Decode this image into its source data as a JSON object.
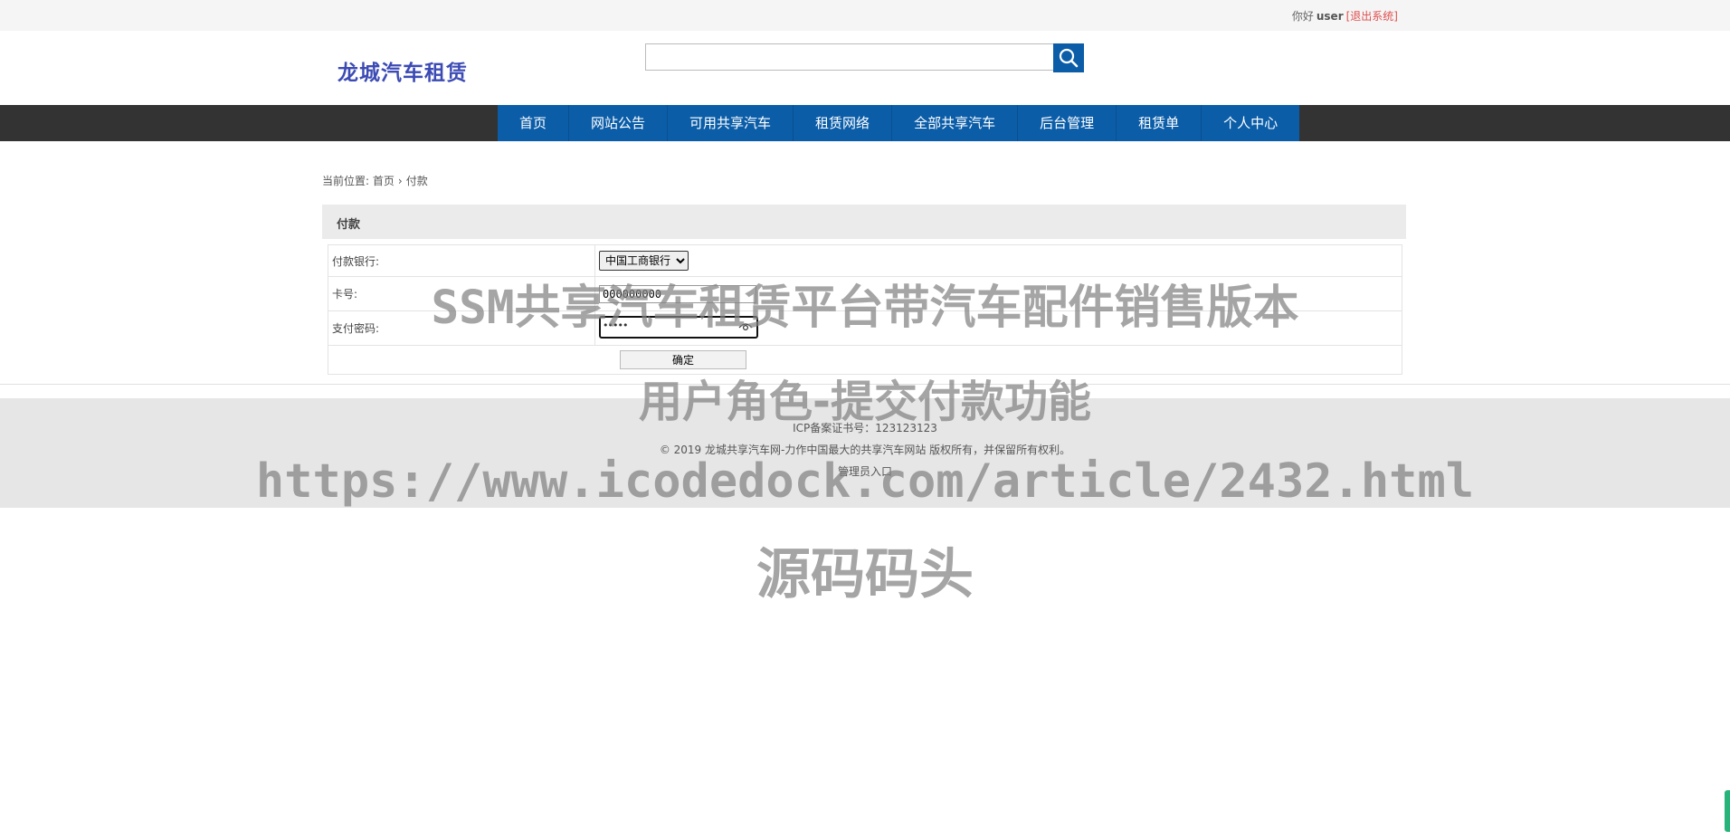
{
  "topbar": {
    "greeting": "你好",
    "username": "user",
    "logout": "[退出系统]"
  },
  "header": {
    "logo": "龙城汽车租赁",
    "search": {
      "value": "",
      "placeholder": ""
    },
    "search_icon": "search-icon"
  },
  "nav": {
    "items": [
      "首页",
      "网站公告",
      "可用共享汽车",
      "租赁网络",
      "全部共享汽车",
      "后台管理",
      "租赁单",
      "个人中心"
    ]
  },
  "breadcrumb": {
    "prefix": "当前位置:",
    "home": "首页",
    "separator": "›",
    "current": "付款"
  },
  "panel": {
    "title": "付款"
  },
  "form": {
    "bank_label": "付款银行:",
    "bank_value": "中国工商银行",
    "card_label": "卡号:",
    "card_value": "000000000",
    "password_label": "支付密码:",
    "password_value": "•••••",
    "submit_label": "确定"
  },
  "footer": {
    "icp": "ICP备案证书号：123123123",
    "copyright": "© 2019 龙城共享汽车网-力作中国最大的共享汽车网站 版权所有，并保留所有权利。",
    "admin_link": "管理员入口"
  },
  "watermark": {
    "line1": "SSM共享汽车租赁平台带汽车配件销售版本",
    "line2": "用户角色-提交付款功能",
    "line3": "https://www.icodedock.com/article/2432.html",
    "line4": "源码码头"
  },
  "colors": {
    "nav_blue": "#0b5da8",
    "nav_bar": "#333333",
    "logo": "#3c4bb4",
    "logout": "#e05050"
  }
}
